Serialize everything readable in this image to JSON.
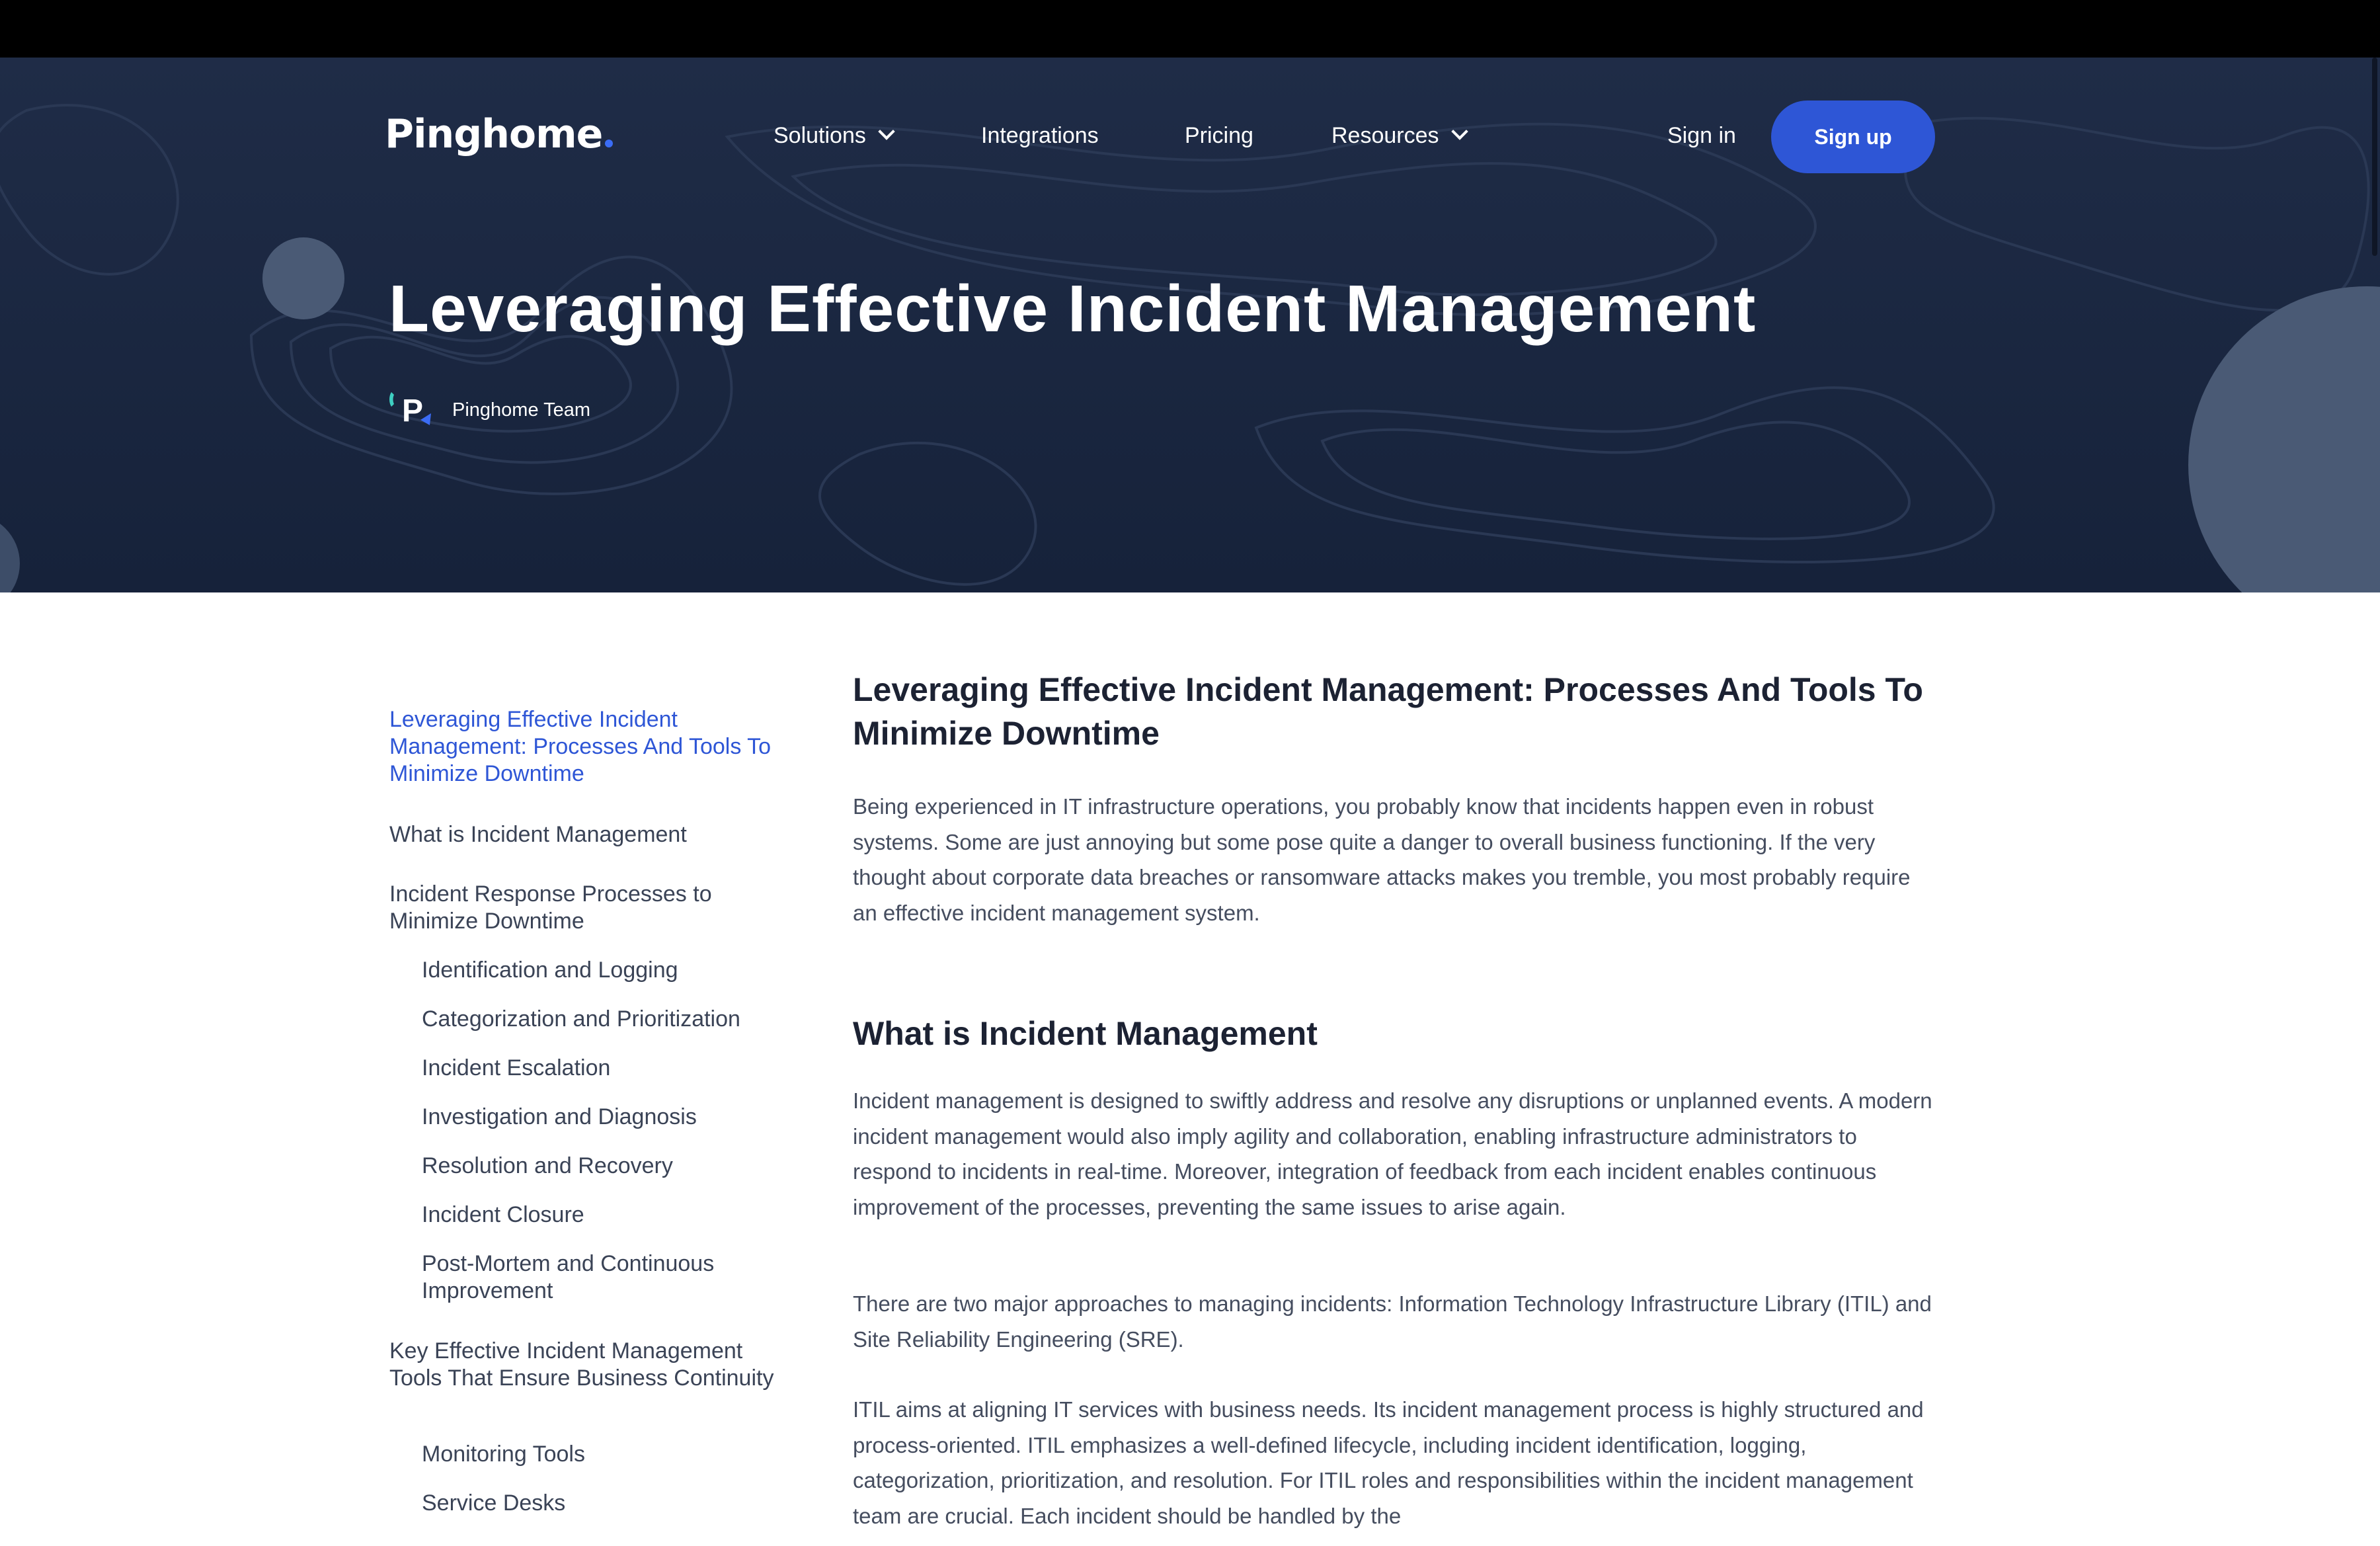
{
  "header": {
    "logo_text": "Pinghome",
    "nav": {
      "solutions": "Solutions",
      "integrations": "Integrations",
      "pricing": "Pricing",
      "resources": "Resources"
    },
    "sign_in": "Sign in",
    "sign_up": "Sign up"
  },
  "hero": {
    "title": "Leveraging Effective Incident Management",
    "author": "Pinghome Team",
    "author_icon": "pinghome-logo-icon"
  },
  "toc": {
    "items": [
      "Leveraging Effective Incident Management: Processes And Tools To Minimize Downtime",
      "What is Incident Management",
      "Incident Response Processes to Minimize Downtime",
      "Identification and Logging",
      "Categorization and Prioritization",
      "Incident Escalation",
      "Investigation and Diagnosis",
      "Resolution and Recovery",
      "Incident Closure",
      "Post-Mortem and Continuous Improvement",
      "Key Effective Incident Management Tools That Ensure Business Continuity",
      "Monitoring Tools",
      "Service Desks"
    ],
    "active_index": 0
  },
  "article": {
    "title": "Leveraging Effective Incident Management: Processes And Tools To Minimize Downtime",
    "intro": "Being experienced in IT infrastructure operations, you probably know that incidents happen even in robust systems. Some are just annoying but some pose quite a danger to overall business functioning. If the very thought about corporate data breaches or ransomware attacks makes you tremble, you most probably require an effective incident management system.",
    "section1_title": "What is Incident Management",
    "section1_p1": "Incident management is designed to swiftly address and resolve any disruptions or unplanned events. A modern incident management would also imply agility and collaboration, enabling infrastructure administrators to respond to incidents in real-time. Moreover, integration of feedback from each incident enables continuous improvement of the processes, preventing the same issues to arise again.",
    "section1_p2": "There are two major approaches to managing incidents: Information Technology Infrastructure Library (ITIL) and Site Reliability Engineering (SRE).",
    "section1_p3": "ITIL aims at aligning IT services with business needs. Its incident management process is highly structured and process-oriented. ITIL emphasizes a well-defined lifecycle, including incident identification, logging, categorization, prioritization, and resolution. For ITIL roles and responsibilities within the incident management team are crucial. Each incident should be handled by the"
  },
  "colors": {
    "hero_bg": "#1f2c47",
    "accent": "#2e56d6",
    "heading": "#1c2233",
    "body_text": "#454d5f",
    "decor_circle": "#4a5a75"
  }
}
